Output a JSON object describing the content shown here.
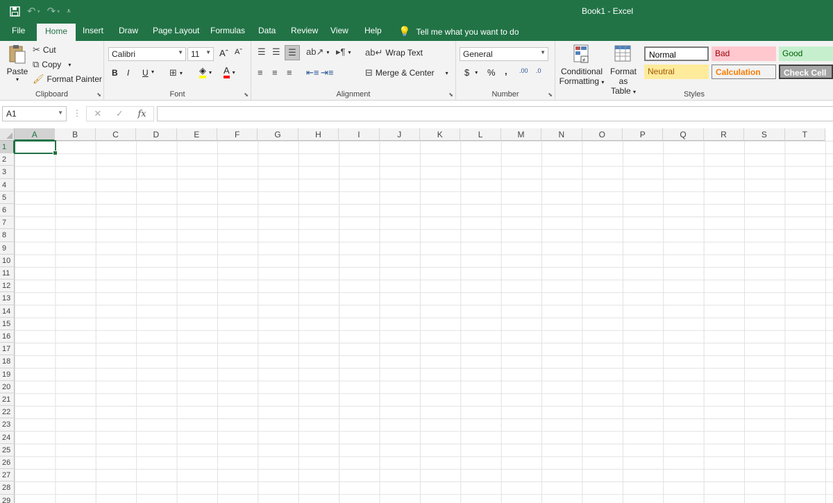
{
  "window": {
    "title": "Book1  -  Excel"
  },
  "qat": {
    "save_icon": "save-icon",
    "undo_icon": "undo-icon",
    "redo_icon": "redo-icon",
    "customize_icon": "customize-qat-icon"
  },
  "tabs": [
    {
      "label": "File"
    },
    {
      "label": "Home"
    },
    {
      "label": "Insert"
    },
    {
      "label": "Draw"
    },
    {
      "label": "Page Layout"
    },
    {
      "label": "Formulas"
    },
    {
      "label": "Data"
    },
    {
      "label": "Review"
    },
    {
      "label": "View"
    },
    {
      "label": "Help"
    }
  ],
  "tell_me": "Tell me what you want to do",
  "clipboard": {
    "label": "Clipboard",
    "paste": "Paste",
    "cut": "Cut",
    "copy": "Copy",
    "format_painter": "Format Painter"
  },
  "font": {
    "label": "Font",
    "name": "Calibri",
    "size": "11",
    "bold": "B",
    "italic": "I",
    "underline": "U",
    "grow": "Aˆ",
    "shrink": "Aˇ",
    "font_color": "A"
  },
  "alignment": {
    "label": "Alignment",
    "wrap_text": "Wrap Text",
    "merge_center": "Merge & Center"
  },
  "number": {
    "label": "Number",
    "format": "General",
    "currency": "$",
    "percent": "%",
    "comma": ",",
    "inc_decimal": ".00",
    "dec_decimal": ".0"
  },
  "styles_group": {
    "label": "Styles",
    "conditional_formatting": [
      "Conditional",
      "Formatting"
    ],
    "format_as_table": [
      "Format as",
      "Table"
    ],
    "cells": [
      {
        "label": "Normal",
        "bg": "#ffffff",
        "color": "#000000"
      },
      {
        "label": "Bad",
        "bg": "#ffc7ce",
        "color": "#9c0006"
      },
      {
        "label": "Good",
        "bg": "#c6efce",
        "color": "#006100"
      },
      {
        "label": "Neutral",
        "bg": "#ffeb9c",
        "color": "#9c5700"
      },
      {
        "label": "Calculation",
        "bg": "#f2f2f2",
        "color": "#fa7d00"
      },
      {
        "label": "Check Cell",
        "bg": "#a5a5a5",
        "color": "#ffffff"
      }
    ]
  },
  "formula_bar": {
    "name_box": "A1",
    "fx": "fx",
    "value": ""
  },
  "columns": [
    "A",
    "B",
    "C",
    "D",
    "E",
    "F",
    "G",
    "H",
    "I",
    "J",
    "K",
    "L",
    "M",
    "N",
    "O",
    "P",
    "Q",
    "R",
    "S",
    "T"
  ],
  "rows": [
    "1",
    "2",
    "3",
    "4",
    "5",
    "6",
    "7",
    "8",
    "9",
    "10",
    "11",
    "12",
    "13",
    "14",
    "15",
    "16",
    "17",
    "18",
    "19",
    "20",
    "21",
    "22",
    "23",
    "24",
    "25",
    "26",
    "27",
    "28",
    "29"
  ],
  "active_cell": "A1",
  "colors": {
    "brand": "#217346",
    "ribbon": "#f3f3f3"
  }
}
